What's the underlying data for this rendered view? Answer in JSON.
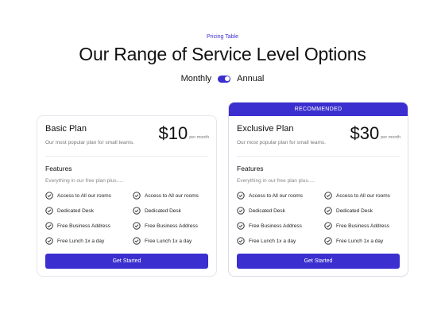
{
  "header": {
    "eyebrow": "Pricing Table",
    "title": "Our Range of Service Level Options"
  },
  "billing": {
    "monthly_label": "Monthly",
    "annual_label": "Annual",
    "selected": "Annual"
  },
  "accent_color": "#3b2fcf",
  "plans": [
    {
      "name": "Basic Plan",
      "subtitle": "Our most popular plan for small teams.",
      "price": "$10",
      "period": "per month",
      "features_title": "Features",
      "features_sub": "Everything in our free plan plus.....",
      "features": [
        "Access to All our rooms",
        "Access to All our rooms",
        "Dedicated Desk",
        "Dedicated Desk",
        "Free Business Address",
        "Free Business Address",
        "Free Lunch 1x a day",
        "Free Lunch 1x a day"
      ],
      "cta": "Get Started"
    },
    {
      "badge": "RECOMMENDED",
      "name": "Exclusive Plan",
      "subtitle": "Our most popular plan for small teams.",
      "price": "$30",
      "period": "per month",
      "features_title": "Features",
      "features_sub": "Everything in our free plan plus.....",
      "features": [
        "Access to All our rooms",
        "Access to All our rooms",
        "Dedicated Desk",
        "Dedicated Desk",
        "Free Business Address",
        "Free Business Address",
        "Free Lunch 1x a day",
        "Free Lunch 1x a day"
      ],
      "cta": "Get Started"
    }
  ]
}
